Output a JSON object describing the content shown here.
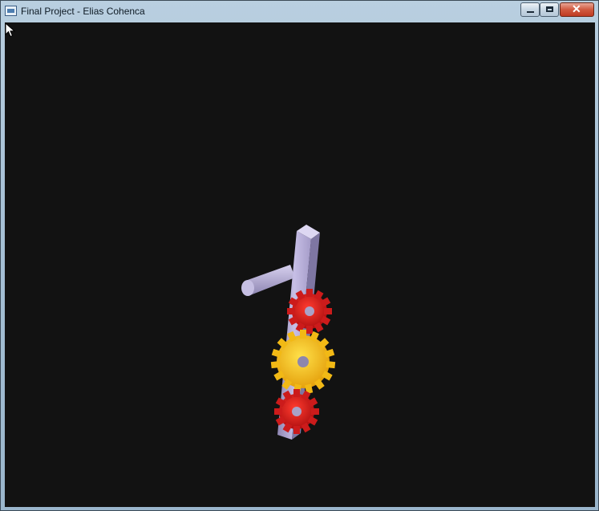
{
  "window": {
    "title": "Final Project - Elias Cohenca"
  },
  "icons": {
    "app": "app-window-icon",
    "minimize": "minimize-icon",
    "maximize": "maximize-icon",
    "close": "close-icon",
    "cursor": "mouse-pointer-icon"
  },
  "colors": {
    "canvas_background": "#121212",
    "beam": "#b8aedb",
    "gear_red": "#d62020",
    "gear_yellow": "#f5c21a"
  }
}
